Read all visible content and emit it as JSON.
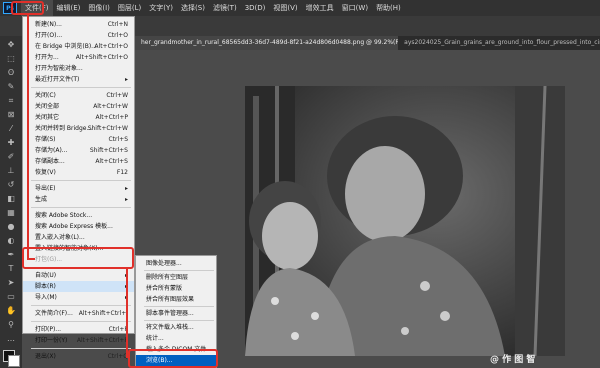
{
  "app": {
    "logo": "Ps"
  },
  "menubar": [
    "文件(F)",
    "编辑(E)",
    "图像(I)",
    "图层(L)",
    "文字(Y)",
    "选择(S)",
    "滤镜(T)",
    "3D(D)",
    "视图(V)",
    "增效工具",
    "窗口(W)",
    "帮助(H)"
  ],
  "tabs": [
    {
      "label": "her_grandmother_in_rural_68565dd3-36d7-489d-8f21-a24d806d0488.png @ 99.2%(RGB/8#) *"
    },
    {
      "label": "ays2024025_Grain_grains_are_ground_into_flour_pressed_into_circ_8956fe"
    }
  ],
  "file_menu": [
    {
      "label": "新建(N)...",
      "shortcut": "Ctrl+N"
    },
    {
      "label": "打开(O)...",
      "shortcut": "Ctrl+O"
    },
    {
      "label": "在 Bridge 中浏览(B)...",
      "shortcut": "Alt+Ctrl+O"
    },
    {
      "label": "打开为...",
      "shortcut": "Alt+Shift+Ctrl+O"
    },
    {
      "label": "打开为智能对象...",
      "shortcut": ""
    },
    {
      "label": "最近打开文件(T)",
      "shortcut": "",
      "arrow": true
    },
    {
      "label": "关闭(C)",
      "shortcut": "Ctrl+W"
    },
    {
      "label": "关闭全部",
      "shortcut": "Alt+Ctrl+W"
    },
    {
      "label": "关闭其它",
      "shortcut": "Alt+Ctrl+P"
    },
    {
      "label": "关闭并转到 Bridge...",
      "shortcut": "Shift+Ctrl+W"
    },
    {
      "label": "存储(S)",
      "shortcut": "Ctrl+S"
    },
    {
      "label": "存储为(A)...",
      "shortcut": "Shift+Ctrl+S"
    },
    {
      "label": "存储副本...",
      "shortcut": "Alt+Ctrl+S"
    },
    {
      "label": "恢复(V)",
      "shortcut": "F12"
    },
    {
      "label": "导出(E)",
      "shortcut": "",
      "arrow": true
    },
    {
      "label": "生成",
      "shortcut": "",
      "arrow": true
    },
    {
      "label": "搜索 Adobe Stock...",
      "shortcut": ""
    },
    {
      "label": "搜索 Adobe Express 模板...",
      "shortcut": ""
    },
    {
      "label": "置入嵌入对象(L)...",
      "shortcut": ""
    },
    {
      "label": "置入链接的智能对象(K)...",
      "shortcut": ""
    },
    {
      "label": "打包(G)...",
      "shortcut": "",
      "disabled": true
    },
    {
      "label": "自动(U)",
      "shortcut": "",
      "arrow": true
    },
    {
      "label": "脚本(R)",
      "shortcut": "",
      "arrow": true
    },
    {
      "label": "导入(M)",
      "shortcut": "",
      "arrow": true
    },
    {
      "label": "文件简介(F)...",
      "shortcut": "Alt+Shift+Ctrl+I"
    },
    {
      "label": "打印(P)...",
      "shortcut": "Ctrl+P"
    },
    {
      "label": "打印一份(Y)",
      "shortcut": "Alt+Shift+Ctrl+P"
    },
    {
      "label": "退出(X)",
      "shortcut": "Ctrl+Q"
    }
  ],
  "script_submenu": [
    {
      "label": "图像处理器..."
    },
    {
      "label": "删除所有空图层"
    },
    {
      "label": "拼合所有蒙版"
    },
    {
      "label": "拼合所有图层效果"
    },
    {
      "label": "脚本事件管理器..."
    },
    {
      "label": "将文件载入堆栈..."
    },
    {
      "label": "统计..."
    },
    {
      "label": "载入多个 DICOM 文件..."
    },
    {
      "label": "浏览(B)..."
    }
  ],
  "watermark": "@ 作 图 智"
}
